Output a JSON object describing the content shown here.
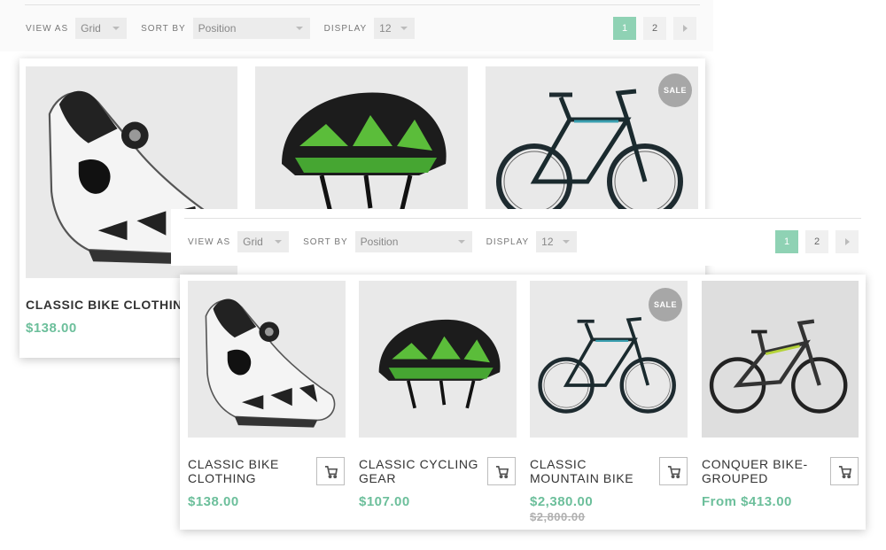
{
  "toolbar": {
    "view_as_label": "VIEW AS",
    "view_as_value": "Grid",
    "sort_by_label": "SORT BY",
    "sort_by_value": "Position",
    "display_label": "DISPLAY",
    "display_value": "12"
  },
  "pager": {
    "pages": [
      "1",
      "2"
    ],
    "active": "1",
    "next_icon": "chevron-right-icon"
  },
  "badge": "SALE",
  "back_products": [
    {
      "name": "CLASSIC BIKE CLOTHING",
      "price": "$138.00"
    }
  ],
  "products": [
    {
      "name_line1": "CLASSIC BIKE",
      "name_line2": "CLOTHING",
      "price": "$138.00",
      "old_price": "",
      "image": "cycling-shoe"
    },
    {
      "name_line1": "CLASSIC CYCLING",
      "name_line2": "GEAR",
      "price": "$107.00",
      "old_price": "",
      "image": "helmet"
    },
    {
      "name_line1": "CLASSIC",
      "name_line2": "MOUNTAIN BIKE",
      "price": "$2,380.00",
      "old_price": "$2,800.00",
      "image": "mountain-bike",
      "badge": "SALE"
    },
    {
      "name_line1": "CONQUER BIKE-",
      "name_line2": "GROUPED",
      "price": "From $413.00",
      "old_price": "",
      "image": "full-suspension-bike"
    }
  ],
  "colors": {
    "accent": "#6cbf9b",
    "pager_active": "#8fd2b4",
    "badge": "#a7a7a7"
  },
  "icons": {
    "cart": "cart-icon",
    "caret": "caret-down-icon"
  }
}
